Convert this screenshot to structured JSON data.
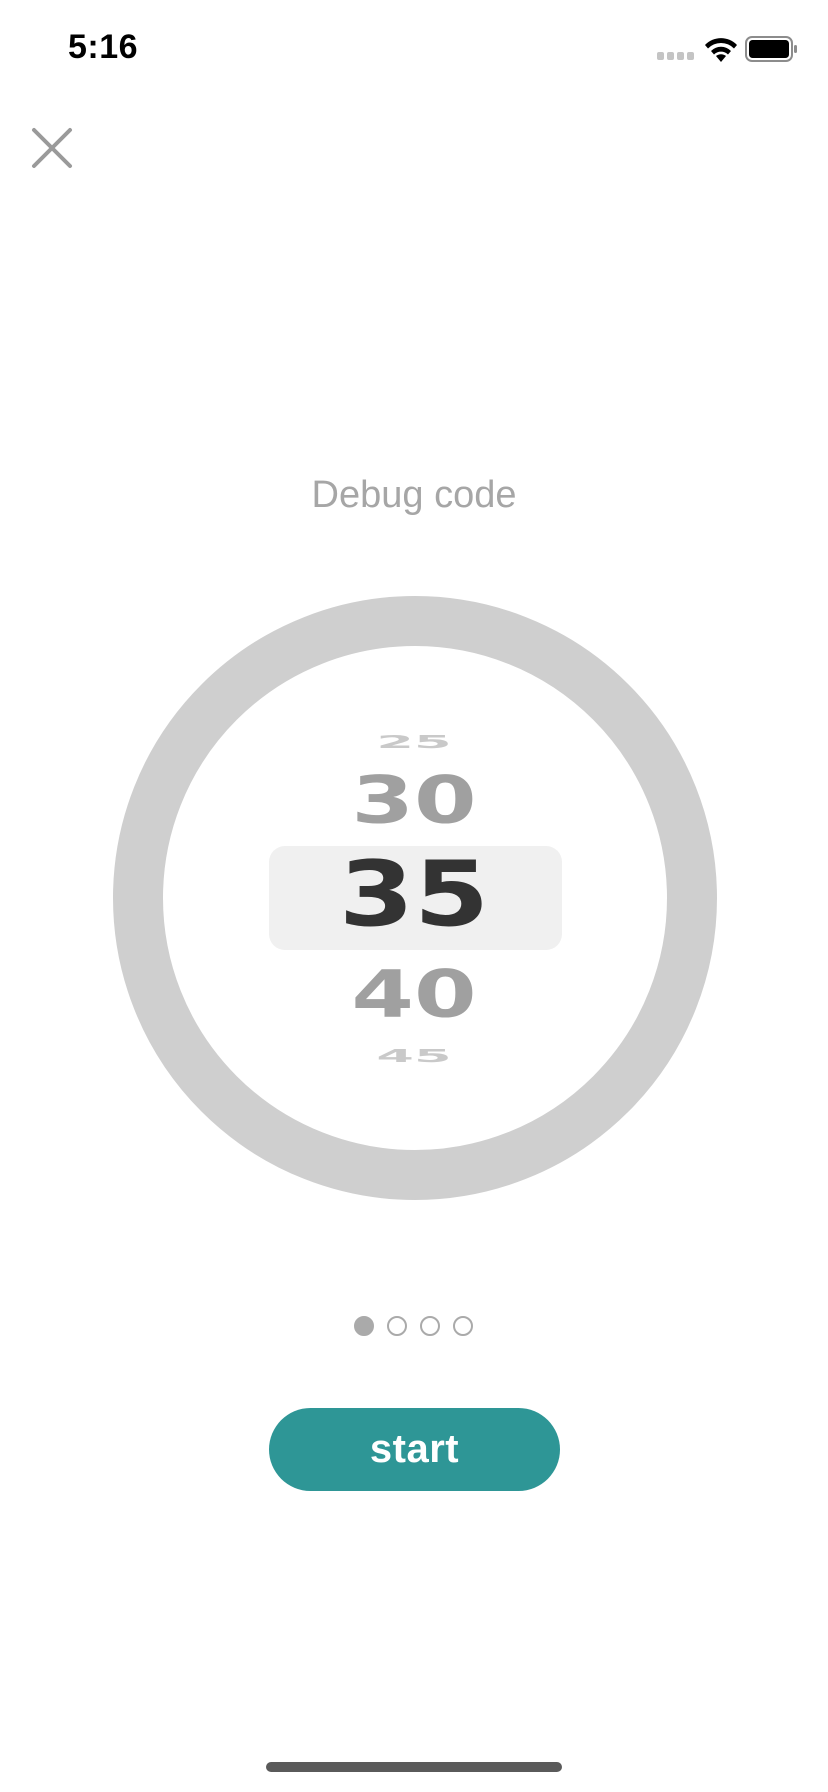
{
  "status_bar": {
    "time": "5:16",
    "icons": [
      "cellular-signal-icon",
      "wifi-icon",
      "battery-icon"
    ]
  },
  "close_icon": "close-icon",
  "title": "Debug code",
  "picker": {
    "values": [
      "25",
      "30",
      "35",
      "40",
      "45"
    ],
    "selected": "35"
  },
  "pagination": {
    "total": 4,
    "active_index": 0
  },
  "start_button": {
    "label": "start"
  },
  "colors": {
    "accent": "#2e9696",
    "ring": "#cfcfcf",
    "title": "#a6a6a6",
    "selected_number": "#333333"
  }
}
